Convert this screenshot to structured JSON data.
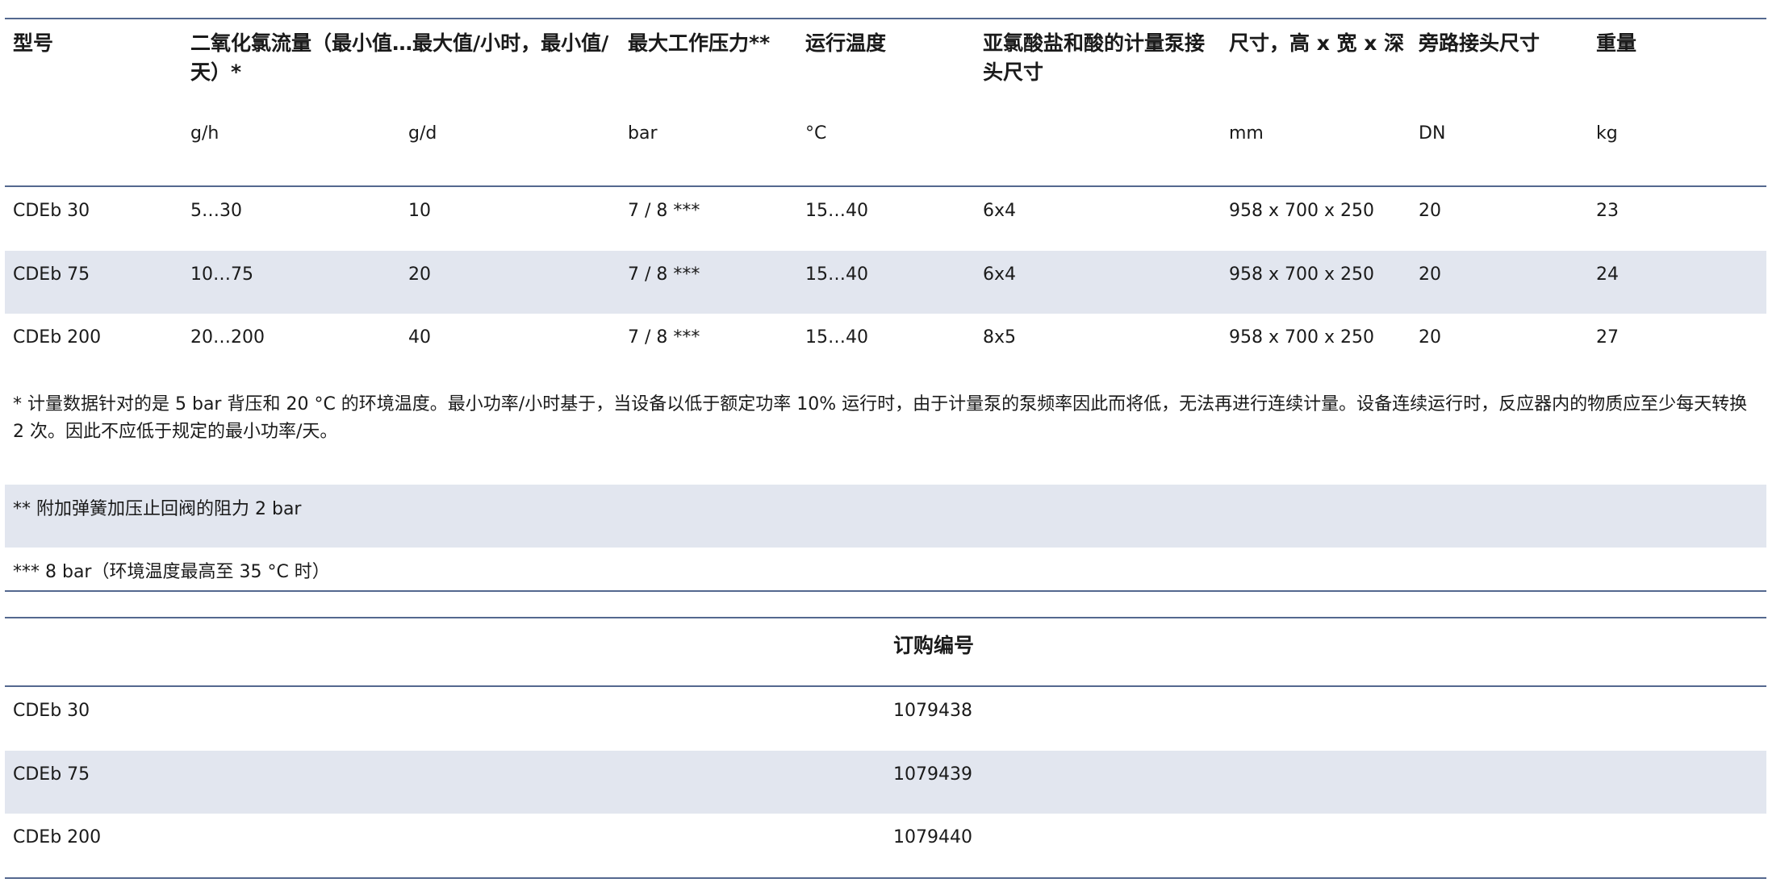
{
  "spec_table": {
    "headers": {
      "model": "型号",
      "flow": "二氧化氯流量（最小值…最大值/小时，最小值/天）*",
      "pressure": "最大工作压力**",
      "temperature": "运行温度",
      "pump_connection": "亚氯酸盐和酸的计量泵接头尺寸",
      "dimensions": "尺寸，高 x 宽 x 深",
      "bypass": "旁路接头尺寸",
      "weight": "重量"
    },
    "units": {
      "flow_h": "g/h",
      "flow_d": "g/d",
      "pressure": "bar",
      "temperature": "°C",
      "dimensions": "mm",
      "bypass": "DN",
      "weight": "kg"
    },
    "rows": [
      {
        "model": "CDEb 30",
        "flow_h": "5…30",
        "flow_d": "10",
        "pressure": "7 / 8 ***",
        "temperature": "15…40",
        "pump_connection": "6x4",
        "dimensions": "958 x 700 x 250",
        "bypass": "20",
        "weight": "23"
      },
      {
        "model": "CDEb 75",
        "flow_h": "10…75",
        "flow_d": "20",
        "pressure": "7 / 8 ***",
        "temperature": "15…40",
        "pump_connection": "6x4",
        "dimensions": "958 x 700 x 250",
        "bypass": "20",
        "weight": "24"
      },
      {
        "model": "CDEb 200",
        "flow_h": "20…200",
        "flow_d": "40",
        "pressure": "7 / 8 ***",
        "temperature": "15…40",
        "pump_connection": "8x5",
        "dimensions": "958 x 700 x 250",
        "bypass": "20",
        "weight": "27"
      }
    ],
    "notes": [
      "* 计量数据针对的是 5 bar 背压和 20 °C 的环境温度。最小功率/小时基于，当设备以低于额定功率 10% 运行时，由于计量泵的泵频率因此而将低，无法再进行连续计量。设备连续运行时，反应器内的物质应至少每天转换 2 次。因此不应低于规定的最小功率/天。",
      "** 附加弹簧加压止回阀的阻力 2 bar",
      "*** 8 bar（环境温度最高至 35 °C 时）"
    ]
  },
  "order_table": {
    "header": "订购编号",
    "rows": [
      {
        "model": "CDEb 30",
        "number": "1079438"
      },
      {
        "model": "CDEb 75",
        "number": "1079439"
      },
      {
        "model": "CDEb 200",
        "number": "1079440"
      }
    ]
  }
}
